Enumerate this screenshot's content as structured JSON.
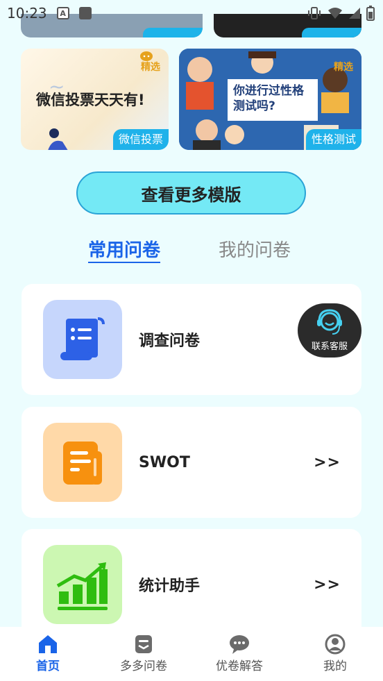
{
  "status_bar": {
    "time": "10:23"
  },
  "banners": [
    {
      "headline": "微信投票天天有!",
      "badge": "微信投票",
      "corner": "精选"
    },
    {
      "headline": "你进行过性格测试吗?",
      "badge": "性格测试",
      "corner": "精选"
    }
  ],
  "more_templates_button": "查看更多模版",
  "tabs": {
    "common": "常用问卷",
    "mine": "我的问卷"
  },
  "items": [
    {
      "label": "调查问卷",
      "arrow": ""
    },
    {
      "label": "SWOT",
      "arrow": ">>"
    },
    {
      "label": "统计助手",
      "arrow": ">>"
    }
  ],
  "customer_service": "联系客服",
  "bottom_nav": [
    {
      "label": "首页"
    },
    {
      "label": "多多问卷"
    },
    {
      "label": "优卷解答"
    },
    {
      "label": "我的"
    }
  ],
  "colors": {
    "accent": "#1a64e8",
    "background": "#ecfdfe",
    "button": "#74e9f5"
  }
}
